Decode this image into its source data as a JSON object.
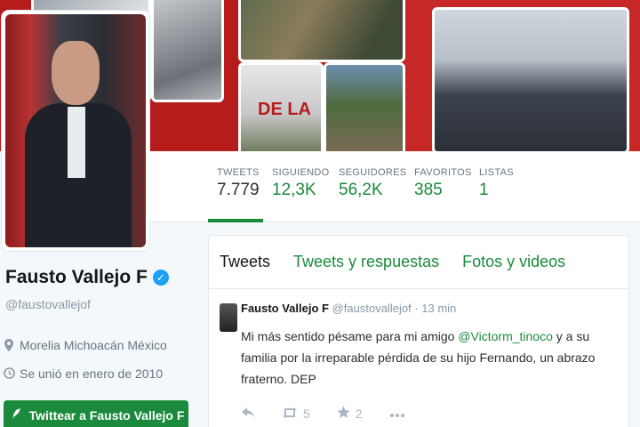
{
  "profile": {
    "name": "Fausto Vallejo F",
    "handle": "@faustovallejof",
    "location": "Morelia Michoacán México",
    "joined": "Se unió en enero de 2010",
    "tweet_button": "Twittear a Fausto Vallejo F"
  },
  "header": {
    "sign_text": "DE LA"
  },
  "stats": [
    {
      "label": "TWEETS",
      "value": "7.779"
    },
    {
      "label": "SIGUIENDO",
      "value": "12,3K"
    },
    {
      "label": "SEGUIDORES",
      "value": "56,2K"
    },
    {
      "label": "FAVORITOS",
      "value": "385"
    },
    {
      "label": "LISTAS",
      "value": "1"
    }
  ],
  "tabs": [
    "Tweets",
    "Tweets y respuestas",
    "Fotos y videos"
  ],
  "tweet": {
    "name": "Fausto Vallejo F",
    "handle": "@faustovallejof",
    "separator": "·",
    "time": "13 min",
    "text_before": "Mi más sentido pésame para mi amigo ",
    "mention": "@Victorm_tinoco",
    "text_after": " y a su familia por la irreparable pérdida de su hijo Fernando, un abrazo fraterno. DEP",
    "retweets": "5",
    "favorites": "2"
  },
  "icons": {
    "verified": "check-badge-icon",
    "location": "location-pin-icon",
    "calendar": "clock-icon",
    "reply": "reply-icon",
    "retweet": "retweet-icon",
    "favorite": "star-icon",
    "more": "more-icon",
    "compose": "quill-icon"
  },
  "colors": {
    "accent": "#1b8a3c",
    "header_red": "#c62828",
    "verified": "#1da1f2"
  }
}
